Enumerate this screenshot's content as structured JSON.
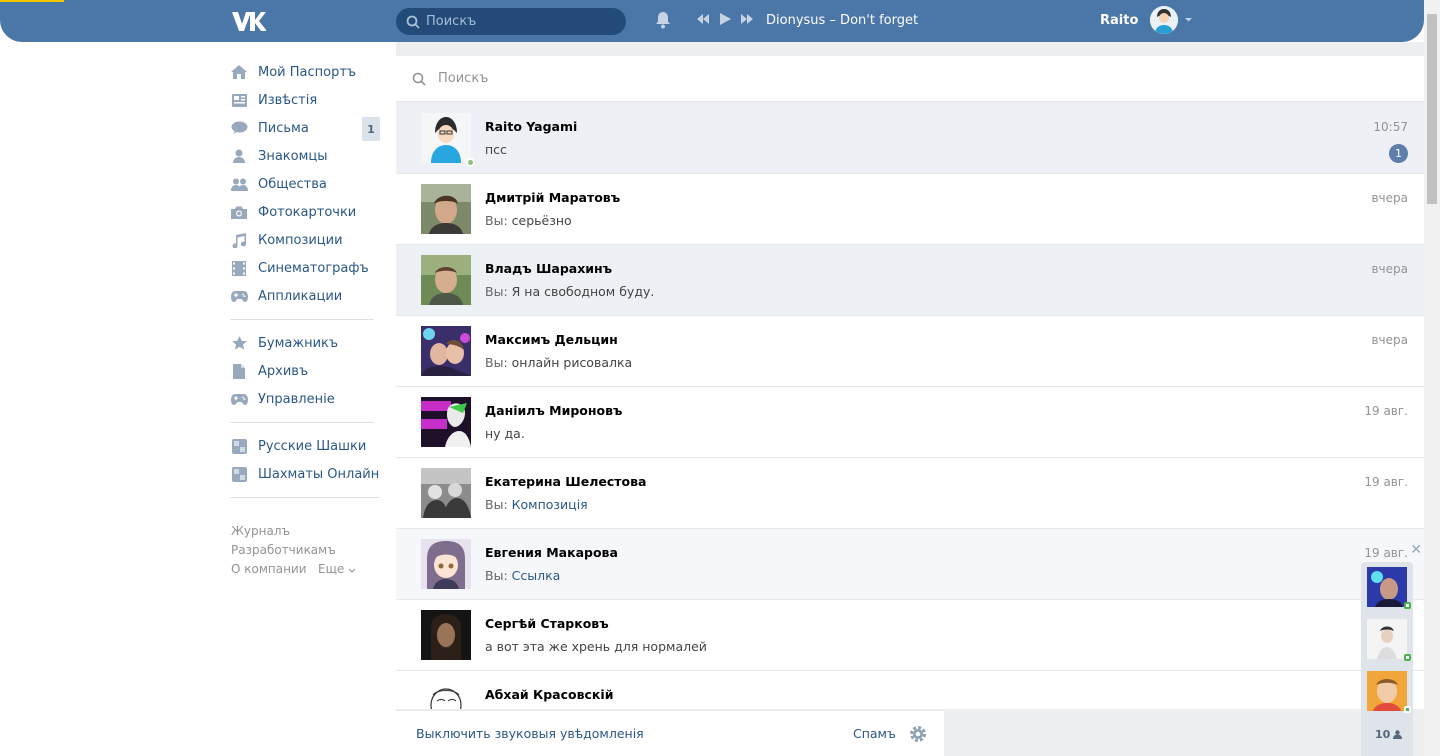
{
  "header": {
    "search_placeholder": "Поискъ",
    "now_playing": "Dionysus – Don't forget",
    "user_name": "Raito"
  },
  "nav": {
    "items": [
      {
        "label": "Мой Паспортъ",
        "icon": "home-icon"
      },
      {
        "label": "Извѣстія",
        "icon": "news-icon"
      },
      {
        "label": "Письма",
        "icon": "messages-icon",
        "badge": "1"
      },
      {
        "label": "Знакомцы",
        "icon": "friends-icon"
      },
      {
        "label": "Общества",
        "icon": "groups-icon"
      },
      {
        "label": "Фотокарточки",
        "icon": "camera-icon"
      },
      {
        "label": "Композиции",
        "icon": "music-icon"
      },
      {
        "label": "Синематографъ",
        "icon": "film-icon"
      },
      {
        "label": "Аппликации",
        "icon": "gamepad-icon"
      }
    ],
    "items2": [
      {
        "label": "Бумажникъ",
        "icon": "star-icon"
      },
      {
        "label": "Архивъ",
        "icon": "document-icon"
      },
      {
        "label": "Управленіе",
        "icon": "gamepad-icon"
      }
    ],
    "items3": [
      {
        "label": "Русские Шашки",
        "icon": "app-icon"
      },
      {
        "label": "Шахматы Онлайн",
        "icon": "app-icon"
      }
    ],
    "footer": {
      "journal": "Журналъ",
      "developers": "Разработчикамъ",
      "about": "О компании",
      "more": "Еще"
    }
  },
  "dialogs": {
    "search_placeholder": "Поискъ",
    "items": [
      {
        "name": "Raito Yagami",
        "you": "",
        "text": "псс",
        "text_link": "",
        "date": "10:57",
        "count": "1",
        "online": true,
        "state": "unread"
      },
      {
        "name": "Дмитрій Маратовъ",
        "you": "Вы:",
        "text": "серьёзно",
        "text_link": "",
        "date": "вчера",
        "count": "",
        "online": false,
        "state": ""
      },
      {
        "name": "Владъ Шарахинъ",
        "you": "Вы:",
        "text": "Я на свободном буду.",
        "text_link": "",
        "date": "вчера",
        "count": "",
        "online": false,
        "state": "unread"
      },
      {
        "name": "Максимъ Дельцин",
        "you": "Вы:",
        "text": "онлайн рисовалка",
        "text_link": "",
        "date": "вчера",
        "count": "",
        "online": false,
        "state": ""
      },
      {
        "name": "Даніилъ Мироновъ",
        "you": "",
        "text": "ну да.",
        "text_link": "",
        "date": "19 авг.",
        "count": "",
        "online": false,
        "state": ""
      },
      {
        "name": "Екатерина Шелестова",
        "you": "Вы:",
        "text": "",
        "text_link": "Композиція",
        "date": "19 авг.",
        "count": "",
        "online": false,
        "state": ""
      },
      {
        "name": "Евгения Макарова",
        "you": "Вы:",
        "text": "",
        "text_link": "Ссылка",
        "date": "19 авг.",
        "count": "",
        "online": false,
        "state": "hover"
      },
      {
        "name": "Сергѣй Старковъ",
        "you": "",
        "text": "а вот эта же хрень для нормалей",
        "text_link": "",
        "date": "",
        "count": "",
        "online": false,
        "state": ""
      },
      {
        "name": "Абхай Красовскій",
        "you": "",
        "text": "",
        "text_link": "",
        "date": "",
        "count": "",
        "online": false,
        "state": ""
      }
    ]
  },
  "bottom": {
    "sound_toggle": "Выключить звуковыя увѣдомленія",
    "spam": "Спамъ"
  },
  "chat_strip": {
    "count": "10"
  },
  "colors": {
    "header": "#4a76a8",
    "link": "#2a5885",
    "unread_bg": "#edf0f5",
    "online": "#8ac176"
  }
}
